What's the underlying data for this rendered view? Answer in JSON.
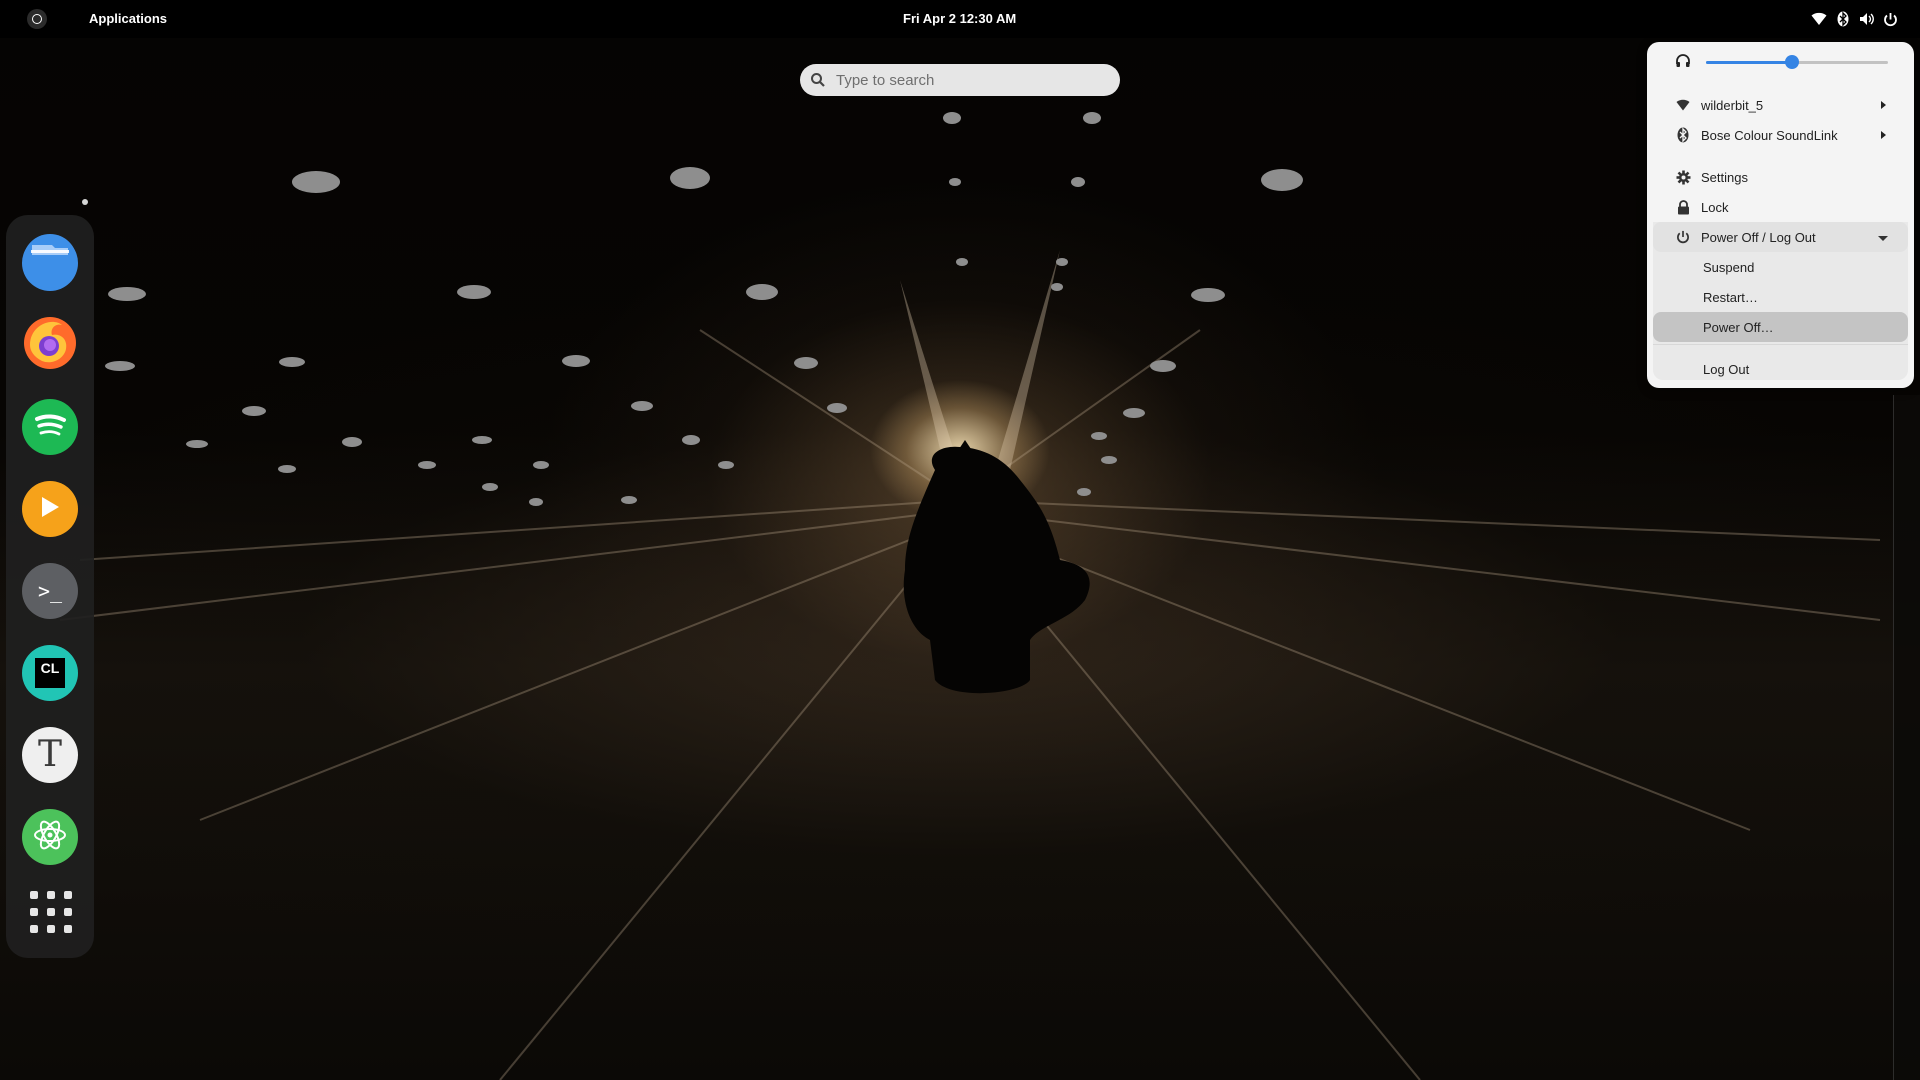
{
  "topbar": {
    "activities_icon": "circle-icon",
    "applications_label": "Applications",
    "clock": "Fri Apr 2  12:30 AM",
    "tray_icons": [
      "wifi-icon",
      "bluetooth-icon",
      "volume-icon",
      "power-icon"
    ]
  },
  "search": {
    "placeholder": "Type to search",
    "value": ""
  },
  "dock": {
    "items": [
      {
        "name": "files",
        "icon": "folder-icon",
        "color": "#3d8fe8"
      },
      {
        "name": "firefox",
        "icon": "firefox-icon",
        "color": "#ff6b2b"
      },
      {
        "name": "spotify",
        "icon": "spotify-icon",
        "color": "#1db954"
      },
      {
        "name": "video-player",
        "icon": "play-icon",
        "color": "#f6a21a"
      },
      {
        "name": "terminal",
        "icon": "terminal-icon",
        "color": "#5d5f63"
      },
      {
        "name": "clion",
        "icon": "clion-icon",
        "color": "#21c5b5"
      },
      {
        "name": "text-editor",
        "icon": "text-editor-icon",
        "color": "#efefef"
      },
      {
        "name": "atom",
        "icon": "atom-icon",
        "color": "#4cc25b"
      }
    ],
    "show_apps_icon": "app-grid-icon",
    "terminal_glyph": ">_",
    "clion_glyph": "CL",
    "text_editor_glyph": "T"
  },
  "system_menu": {
    "volume": {
      "icon": "headphones-icon",
      "level": 0.47
    },
    "wifi": {
      "icon": "wifi-icon",
      "label": "wilderbit_5"
    },
    "bluetooth": {
      "icon": "bluetooth-icon",
      "label": "Bose Colour SoundLink"
    },
    "settings": {
      "icon": "gear-icon",
      "label": "Settings"
    },
    "lock": {
      "icon": "lock-icon",
      "label": "Lock"
    },
    "power": {
      "icon": "power-icon",
      "label": "Power Off / Log Out",
      "submenu": [
        "Suspend",
        "Restart…",
        "Power Off…",
        "Log Out"
      ],
      "highlighted": "Power Off…"
    }
  },
  "colors": {
    "accent": "#3584e4",
    "menu_bg": "#f4f4f4",
    "topbar_bg": "#000000"
  }
}
